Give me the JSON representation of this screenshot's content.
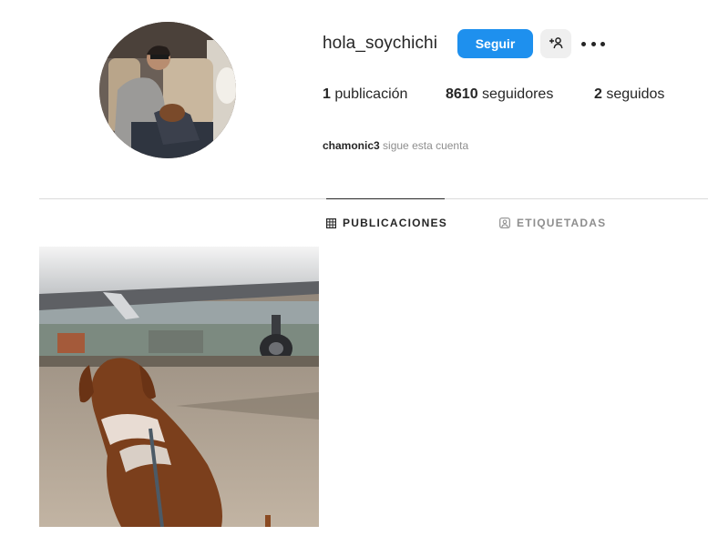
{
  "profile": {
    "username": "hola_soychichi",
    "follow_label": "Seguir",
    "suggest_icon": "add-person-icon",
    "more_icon": "more-options-icon",
    "stats": {
      "posts_count": "1",
      "posts_label": "publicación",
      "followers_count": "8610",
      "followers_label": "seguidores",
      "following_count": "2",
      "following_label": "seguidos"
    },
    "followed_by": {
      "user": "chamonic3",
      "text": "sigue esta cuenta"
    }
  },
  "tabs": [
    {
      "label": "PUBLICACIONES",
      "icon": "grid-icon",
      "active": true
    },
    {
      "label": "ETIQUETADAS",
      "icon": "tagged-user-icon",
      "active": false
    }
  ],
  "colors": {
    "accent": "#1e90ee",
    "text": "#262626",
    "muted": "#8e8e8e",
    "divider": "#dbdbdb"
  }
}
